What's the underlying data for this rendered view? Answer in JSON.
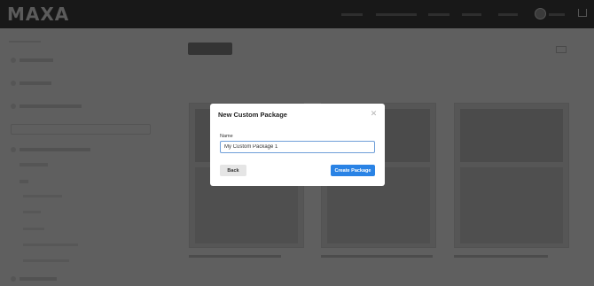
{
  "header": {
    "logo": "MAXA"
  },
  "modal": {
    "title": "New Custom Package",
    "close_icon": "close-icon",
    "name_label": "Name",
    "name_value": "My Custom Package 1",
    "back_label": "Back",
    "create_label": "Create Package"
  },
  "colors": {
    "primary": "#2a83e5",
    "overlay": "#5e5e5e",
    "header": "#181818"
  }
}
